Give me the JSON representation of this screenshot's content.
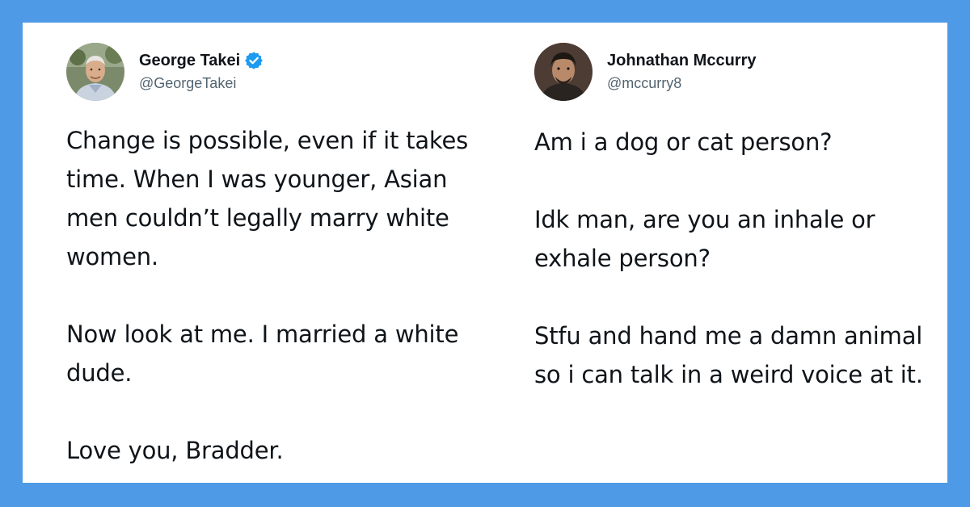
{
  "colors": {
    "background": "#4e9ae6",
    "card": "#ffffff",
    "text": "#0f1419",
    "handle": "#536471",
    "verified": "#1d9bf0"
  },
  "tweets": [
    {
      "name": "George Takei",
      "handle": "@GeorgeTakei",
      "verified": true,
      "avatar_icon": "profile-photo",
      "paragraphs": [
        "Change is possible, even if it takes time. When I was younger, Asian men couldn’t legally marry white women.",
        "Now look at me. I married a white dude.",
        "Love you, Bradder."
      ]
    },
    {
      "name": "Johnathan Mccurry",
      "handle": "@mccurry8",
      "verified": false,
      "avatar_icon": "profile-photo",
      "paragraphs": [
        "Am i a dog or cat person?",
        "Idk man, are you an inhale or exhale person?",
        "Stfu and hand me a damn animal so i can talk in a weird voice at it."
      ]
    }
  ]
}
